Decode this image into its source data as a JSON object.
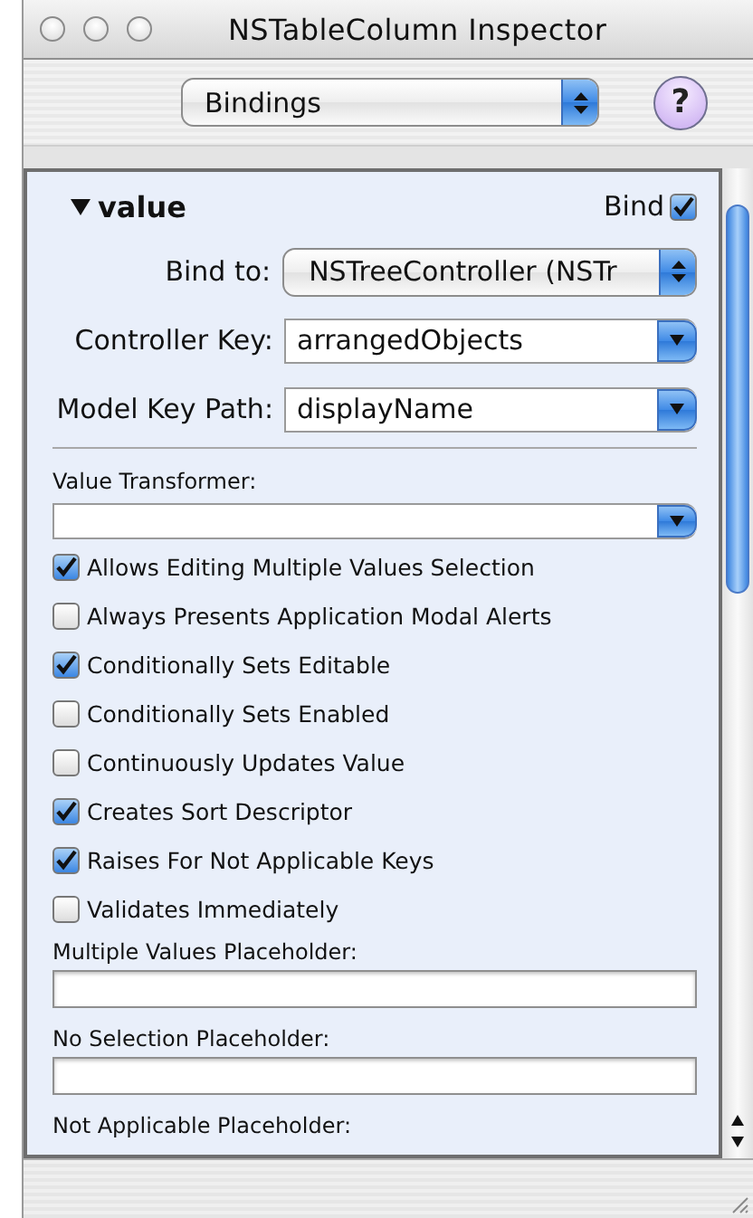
{
  "window": {
    "title": "NSTableColumn Inspector"
  },
  "toolbar": {
    "panel_popup": "Bindings",
    "help_button": "?"
  },
  "binding": {
    "name": "value",
    "expanded": true,
    "bind_label": "Bind",
    "bind_checked": true,
    "fields": [
      {
        "kind": "popup",
        "label": "Bind to:",
        "value": "NSTreeController (NSTr"
      },
      {
        "kind": "combo",
        "label": "Controller Key:",
        "value": "arrangedObjects"
      },
      {
        "kind": "combo",
        "label": "Model Key Path:",
        "value": "displayName"
      }
    ],
    "value_transformer": {
      "label": "Value Transformer:"
    },
    "options": [
      {
        "label": "Allows Editing Multiple Values Selection",
        "checked": true
      },
      {
        "label": "Always Presents Application Modal Alerts",
        "checked": false
      },
      {
        "label": "Conditionally Sets Editable",
        "checked": true
      },
      {
        "label": "Conditionally Sets Enabled",
        "checked": false
      },
      {
        "label": "Continuously Updates Value",
        "checked": false
      },
      {
        "label": "Creates Sort Descriptor",
        "checked": true
      },
      {
        "label": "Raises For Not Applicable Keys",
        "checked": true
      },
      {
        "label": "Validates Immediately",
        "checked": false
      }
    ],
    "placeholders": [
      {
        "label": "Multiple Values Placeholder:"
      },
      {
        "label": "No Selection Placeholder:"
      },
      {
        "label": "Not Applicable Placeholder:"
      }
    ]
  }
}
